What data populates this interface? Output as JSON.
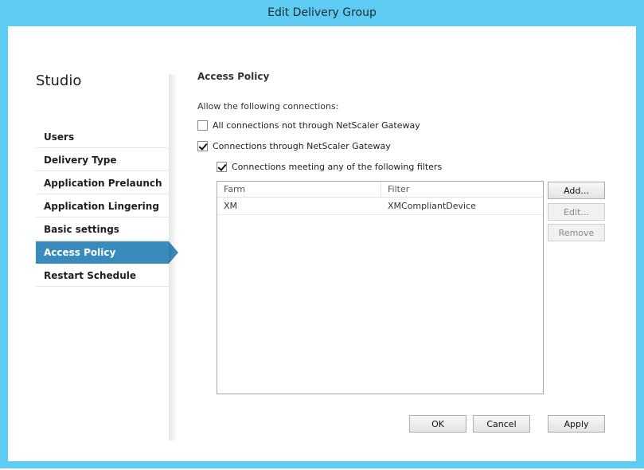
{
  "window": {
    "title": "Edit Delivery Group"
  },
  "sidebar": {
    "title": "Studio",
    "items": [
      {
        "label": "Users"
      },
      {
        "label": "Delivery Type"
      },
      {
        "label": "Application Prelaunch"
      },
      {
        "label": "Application Lingering"
      },
      {
        "label": "Basic settings"
      },
      {
        "label": "Access Policy",
        "active": true
      },
      {
        "label": "Restart Schedule"
      }
    ]
  },
  "main": {
    "section_title": "Access Policy",
    "allow_label": "Allow the following connections:",
    "options": [
      {
        "label": "All connections not through NetScaler Gateway",
        "checked": false
      },
      {
        "label": "Connections through NetScaler Gateway",
        "checked": true
      },
      {
        "label": "Connections meeting any of the following filters",
        "checked": true
      }
    ],
    "filters_table": {
      "columns": [
        "Farm",
        "Filter"
      ],
      "rows": [
        {
          "farm": "XM",
          "filter": "XMCompliantDevice"
        }
      ]
    },
    "side_buttons": {
      "add": "Add...",
      "edit": "Edit...",
      "remove": "Remove"
    }
  },
  "footer": {
    "ok": "OK",
    "cancel": "Cancel",
    "apply": "Apply"
  },
  "colors": {
    "titlebar": "#5ecbf3",
    "nav_active": "#3a8bbd"
  }
}
